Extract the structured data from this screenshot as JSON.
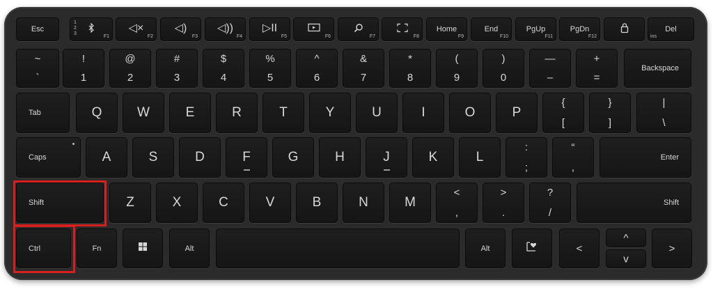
{
  "keyboard": {
    "function_row": [
      {
        "label": "Esc"
      },
      {
        "icon": "bluetooth-icon",
        "f": "F1",
        "sub": "1 2 3"
      },
      {
        "icon": "mute-icon",
        "label": "◁×",
        "f": "F2"
      },
      {
        "icon": "volume-down-icon",
        "label": "◁)",
        "f": "F3"
      },
      {
        "icon": "volume-up-icon",
        "label": "◁))",
        "f": "F4"
      },
      {
        "icon": "play-pause-icon",
        "label": "▷II",
        "f": "F5"
      },
      {
        "icon": "screen-project-icon",
        "f": "F6"
      },
      {
        "icon": "search-icon",
        "f": "F7"
      },
      {
        "icon": "screen-snip-icon",
        "f": "F8"
      },
      {
        "label": "Home",
        "f": "F9"
      },
      {
        "label": "End",
        "f": "F10"
      },
      {
        "label": "PgUp",
        "f": "F11"
      },
      {
        "label": "PgDn",
        "f": "F12"
      },
      {
        "icon": "lock-icon"
      },
      {
        "label": "Del",
        "sub": "ins"
      }
    ],
    "number_row": [
      {
        "top": "~",
        "bot": "`"
      },
      {
        "top": "!",
        "bot": "1"
      },
      {
        "top": "@",
        "bot": "2"
      },
      {
        "top": "#",
        "bot": "3"
      },
      {
        "top": "$",
        "bot": "4"
      },
      {
        "top": "%",
        "bot": "5"
      },
      {
        "top": "^",
        "bot": "6"
      },
      {
        "top": "&",
        "bot": "7"
      },
      {
        "top": "*",
        "bot": "8"
      },
      {
        "top": "(",
        "bot": "9"
      },
      {
        "top": ")",
        "bot": "0"
      },
      {
        "top": "—",
        "bot": "–"
      },
      {
        "top": "+",
        "bot": "="
      },
      {
        "label": "Backspace"
      }
    ],
    "qwerty_row": [
      {
        "label": "Tab"
      },
      {
        "label": "Q"
      },
      {
        "label": "W"
      },
      {
        "label": "E"
      },
      {
        "label": "R"
      },
      {
        "label": "T"
      },
      {
        "label": "Y"
      },
      {
        "label": "U"
      },
      {
        "label": "I"
      },
      {
        "label": "O"
      },
      {
        "label": "P"
      },
      {
        "top": "{",
        "bot": "["
      },
      {
        "top": "}",
        "bot": "]"
      },
      {
        "top": "|",
        "bot": "\\"
      }
    ],
    "home_row": [
      {
        "label": "Caps"
      },
      {
        "label": "A"
      },
      {
        "label": "S"
      },
      {
        "label": "D"
      },
      {
        "label": "F"
      },
      {
        "label": "G"
      },
      {
        "label": "H"
      },
      {
        "label": "J"
      },
      {
        "label": "K"
      },
      {
        "label": "L"
      },
      {
        "top": ":",
        "bot": ";"
      },
      {
        "top": "“",
        "bot": ","
      },
      {
        "label": "Enter"
      }
    ],
    "shift_row": [
      {
        "label": "Shift"
      },
      {
        "label": "Z"
      },
      {
        "label": "X"
      },
      {
        "label": "C"
      },
      {
        "label": "V"
      },
      {
        "label": "B"
      },
      {
        "label": "N"
      },
      {
        "label": "M"
      },
      {
        "top": "<",
        "bot": ","
      },
      {
        "top": ">",
        "bot": "."
      },
      {
        "top": "?",
        "bot": "/"
      },
      {
        "label": "Shift"
      }
    ],
    "bottom_row": [
      {
        "label": "Ctrl"
      },
      {
        "label": "Fn"
      },
      {
        "icon": "windows-icon"
      },
      {
        "label": "Alt"
      },
      {
        "label": ""
      },
      {
        "label": "Alt"
      },
      {
        "icon": "emoji-heart-icon"
      },
      {
        "label": "<"
      },
      {
        "label": "^"
      },
      {
        "label": "v"
      },
      {
        "label": ">"
      }
    ],
    "highlighted": [
      "Shift",
      "Ctrl"
    ],
    "colors": {
      "body": "#2b2b2b",
      "key": "#1a1a1a",
      "label": "#d8d8d8",
      "highlight": "#d62020"
    }
  }
}
